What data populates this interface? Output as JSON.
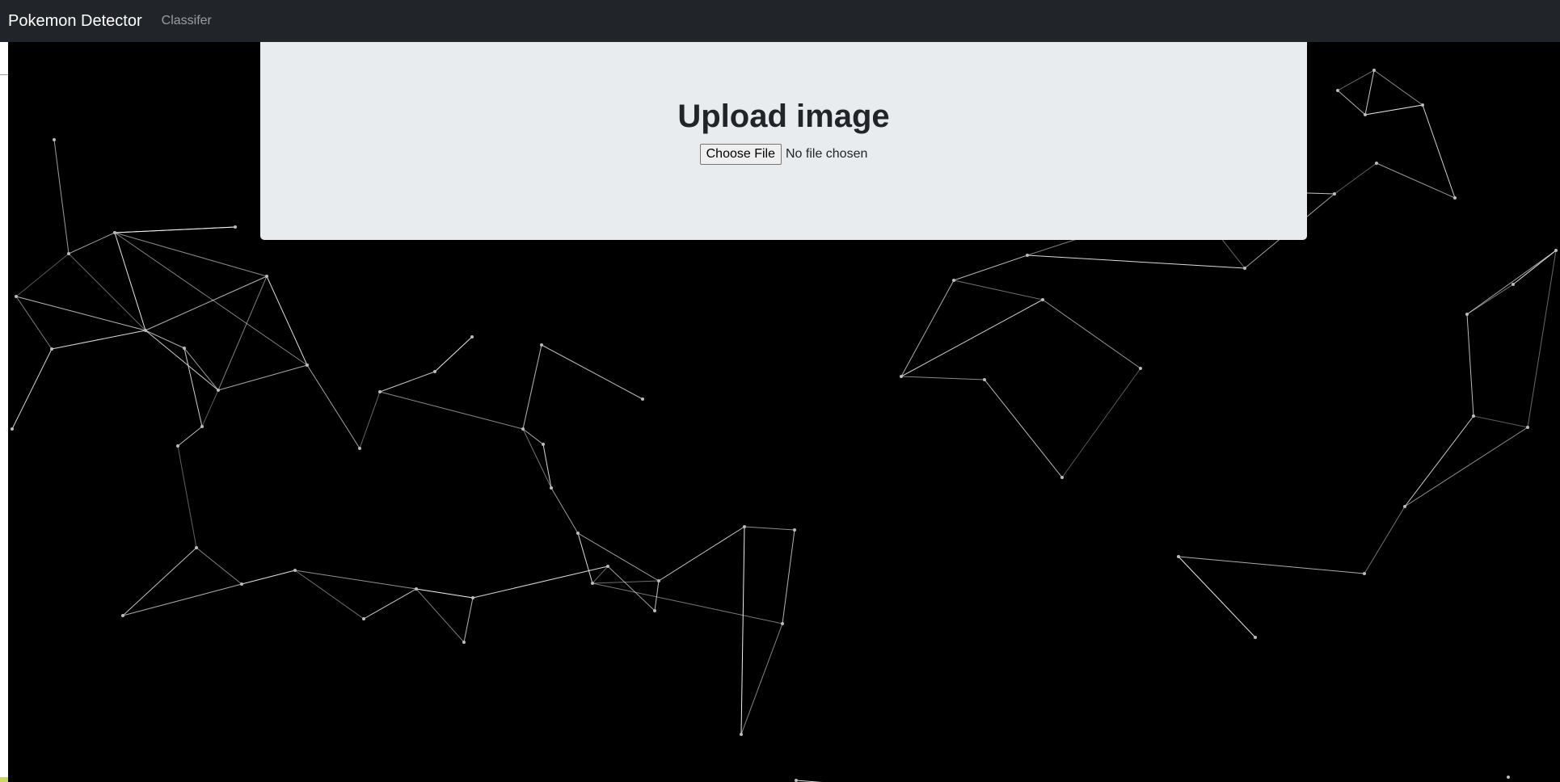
{
  "navbar": {
    "brand": "Pokemon Detector",
    "links": [
      "Classifer"
    ]
  },
  "upload": {
    "title": "Upload image",
    "file_button_label": "Choose File",
    "file_status": "No file chosen"
  },
  "colors": {
    "navbar_bg": "#212529",
    "jumbotron_bg": "#e9ecef",
    "page_bg": "#000000",
    "network_line": "#ffffff"
  }
}
